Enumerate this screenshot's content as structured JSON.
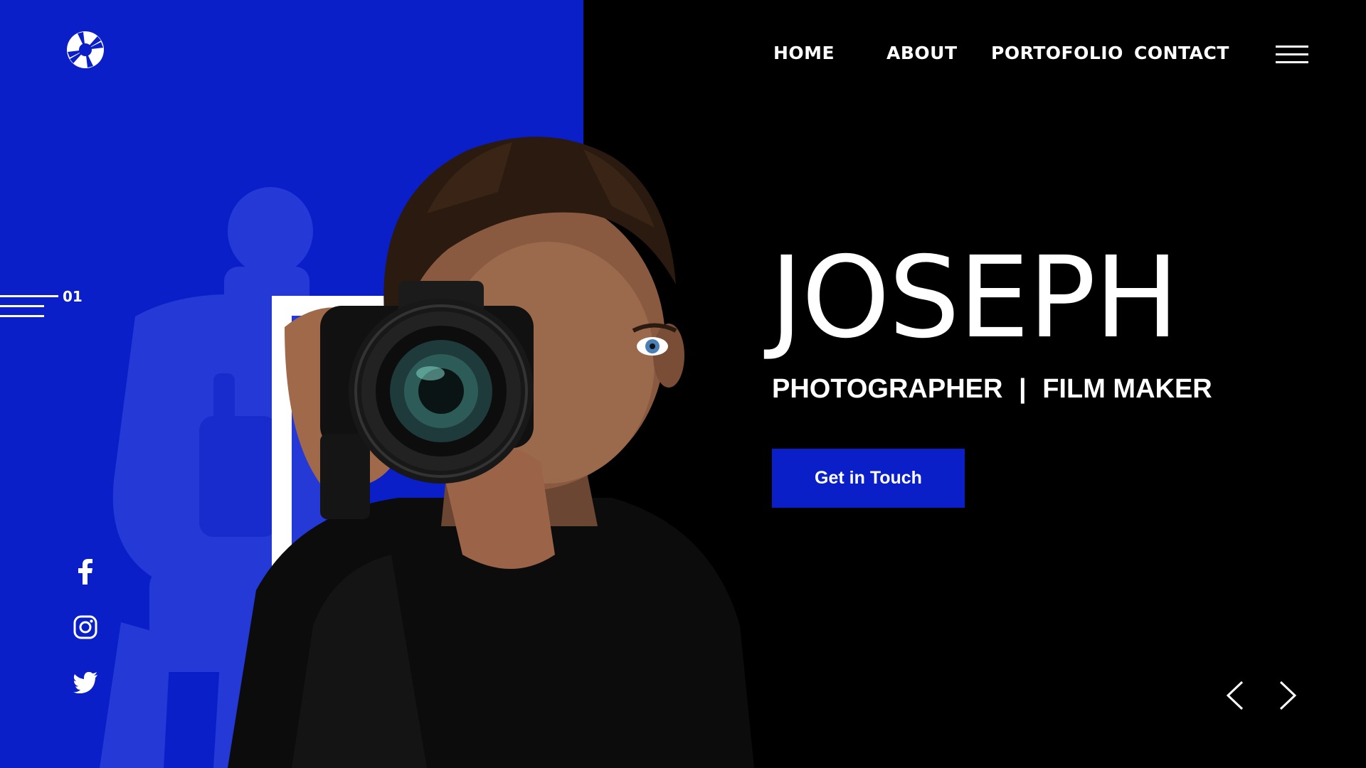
{
  "brand": {
    "logo_icon": "camera-aperture-icon"
  },
  "nav": {
    "items": [
      {
        "label": "HOME"
      },
      {
        "label": "ABOUT"
      },
      {
        "label": "PORTOFOLIO"
      },
      {
        "label": "CONTACT"
      }
    ],
    "menu_icon": "hamburger-menu-icon"
  },
  "slide": {
    "number": "01"
  },
  "hero": {
    "name": "JOSEPH",
    "subtitle_left": "PHOTOGRAPHER",
    "subtitle_sep": "|",
    "subtitle_right": "FILM MAKER",
    "cta_label": "Get in Touch"
  },
  "social": [
    {
      "icon": "facebook-icon"
    },
    {
      "icon": "instagram-icon"
    },
    {
      "icon": "twitter-icon"
    }
  ],
  "carousel": {
    "prev_icon": "chevron-left-icon",
    "next_icon": "chevron-right-icon"
  },
  "colors": {
    "accent": "#0a1fc8",
    "background": "#000000",
    "text": "#ffffff"
  }
}
